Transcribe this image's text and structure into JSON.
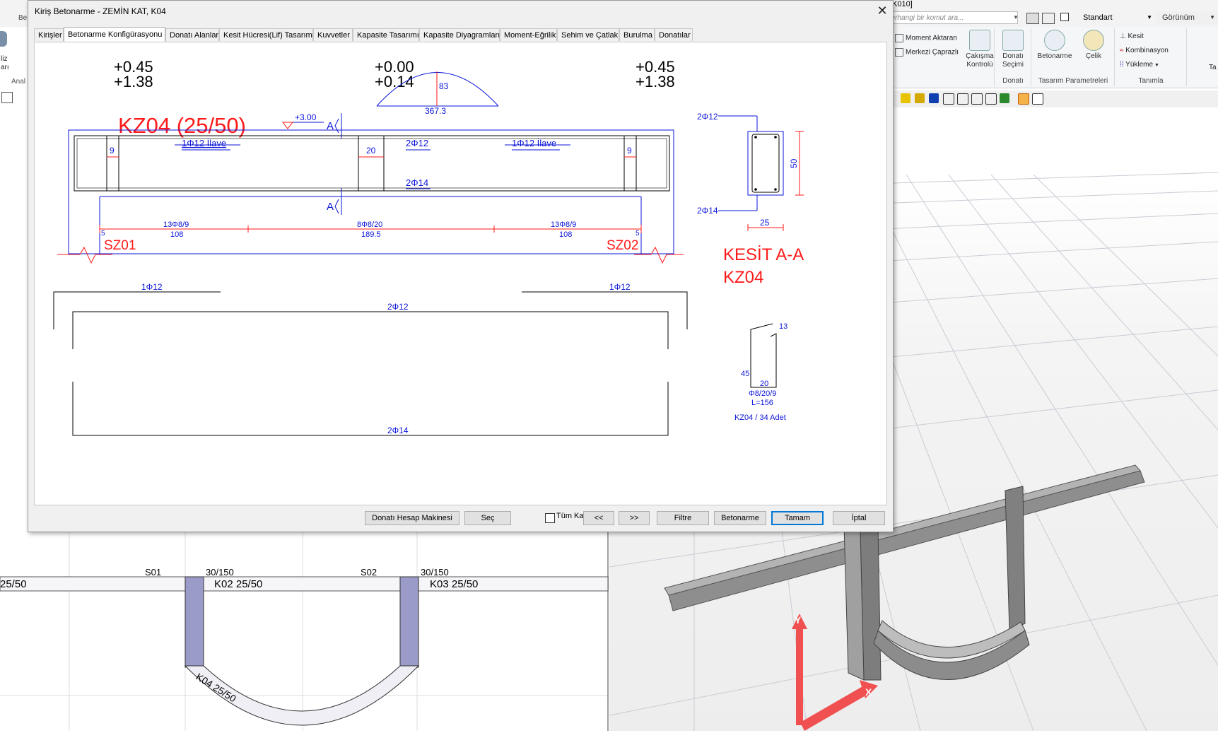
{
  "app": {
    "titlebar_fragment": "K010]",
    "search_placeholder": "herhangi bir komut ara...",
    "style_select": "Standart",
    "view_select": "Görünüm",
    "ribbon": {
      "analysis_fragment_1": "liz",
      "analysis_fragment_2": "arı",
      "analysis_group_fragment": "Anal",
      "be_fragment": "Be",
      "small_buttons": [
        "Moment Aktaran",
        "Merkezi Çaprazlı"
      ],
      "clash_button": [
        "Çakışma",
        "Kontrolü"
      ],
      "rebar_select_button": [
        "Donatı",
        "Seçimi"
      ],
      "rebar_group_label": "Donatı",
      "concrete_button": "Betonarme",
      "steel_button": "Çelik",
      "design_params_label": "Tasarım Parametreleri",
      "section_button": "Kesit",
      "combination_button": "Kombinasyon",
      "loading_button": "Yükleme",
      "definition_label": "Tanımla",
      "ta_fragment": "Ta"
    }
  },
  "dialog": {
    "title": "Kiriş Betonarme - ZEMİN KAT, K04",
    "tabs": [
      "Kirişler",
      "Betonarme Konfigürasyonu",
      "Donatı Alanları",
      "Kesit Hücresi(Lif) Tasarımı",
      "Kuvvetler",
      "Kapasite Tasarımı",
      "Kapasite Diyagramları",
      "Moment-Eğrilik",
      "Sehim ve Çatlak",
      "Burulma",
      "Donatılar"
    ],
    "active_tab": 1,
    "buttons": {
      "calculator": "Donatı Hesap Makinesi",
      "select": "Seç",
      "all_floors": "Tüm Katlar",
      "prev": "<<",
      "next": ">>",
      "filter": "Filtre",
      "concrete": "Betonarme",
      "ok": "Tamam",
      "cancel": "İptal"
    },
    "drawing": {
      "left_top_a": "+0.45",
      "left_top_b": "+1.38",
      "mid_top_a": "+0.00",
      "mid_top_b": "+0.14",
      "right_top_a": "+0.45",
      "right_top_b": "+1.38",
      "arc_height": "83",
      "arc_span": "367.3",
      "beam_title": "KZ04 (25/50)",
      "elevation": "+3.00",
      "section_mark": "A",
      "top_left_extra": "1Φ12 İlave",
      "top_mid": "2Φ12",
      "top_right_extra": "1Φ12 İlave",
      "bottom_mid": "2Φ14",
      "dim_left_9": "9",
      "dim_mid_20": "20",
      "dim_right_9": "9",
      "stirrup_left": "13Φ8/9",
      "stirrup_left_len": "108",
      "stirrup_mid": "8Φ8/20",
      "stirrup_mid_len": "189.5",
      "stirrup_right": "13Φ8/9",
      "stirrup_right_len": "108",
      "offset_5_left": "5",
      "offset_5_right": "5",
      "support_left": "SZ01",
      "support_right": "SZ02",
      "sec_top": "2Φ12",
      "sec_bottom": "2Φ14",
      "sec_height": "50",
      "sec_width": "25",
      "sec_title": "KESİT A-A",
      "sec_beam": "KZ04",
      "bar_top_left": "1Φ12",
      "bar_top_right": "1Φ12",
      "bar_main_top": "2Φ12",
      "bar_main_bottom": "2Φ14",
      "stirrup_hook": "13",
      "stirrup_h": "45",
      "stirrup_w": "20",
      "stirrup_spec": "Φ8/20/9",
      "stirrup_length": "L=156",
      "stirrup_count": "KZ04 / 34 Adet"
    }
  },
  "plan": {
    "col_left": "S01",
    "col_left_size": "30/150",
    "col_right": "S02",
    "col_right_size": "30/150",
    "beam_left": "25/50",
    "beam_mid": "K02 25/50",
    "beam_right": "K03 25/50",
    "beam_curve": "K04 25/50"
  },
  "view3d": {
    "axis_y": "Y",
    "axis_x": "X"
  },
  "colors": {
    "drawing_red": "#ff1a1a",
    "drawing_blue": "#0a14d8",
    "accent": "#0078d7"
  }
}
